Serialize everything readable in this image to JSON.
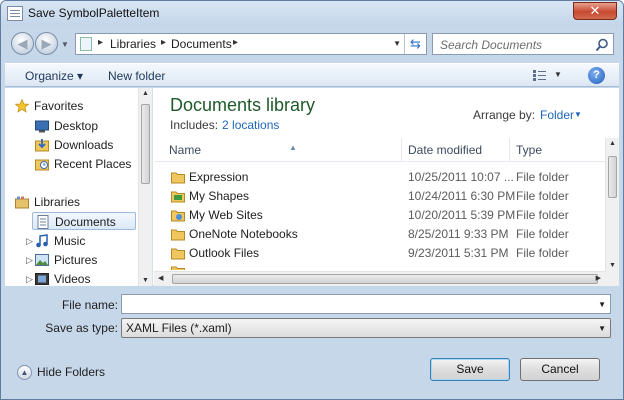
{
  "window": {
    "title": "Save SymbolPaletteItem",
    "close_glyph": "✕"
  },
  "address": {
    "crumbs": [
      "Libraries",
      "Documents"
    ],
    "separator": "▸",
    "search_placeholder": "Search Documents"
  },
  "toolbar": {
    "organize_label": "Organize ▾",
    "new_folder_label": "New folder",
    "help_glyph": "?"
  },
  "sidebar": {
    "favorites": {
      "label": "Favorites",
      "items": [
        {
          "label": "Desktop",
          "icon": "desktop-icon"
        },
        {
          "label": "Downloads",
          "icon": "downloads-icon"
        },
        {
          "label": "Recent Places",
          "icon": "recent-places-icon"
        }
      ]
    },
    "libraries": {
      "label": "Libraries",
      "items": [
        {
          "label": "Documents",
          "icon": "documents-icon",
          "selected": true
        },
        {
          "label": "Music",
          "icon": "music-icon"
        },
        {
          "label": "Pictures",
          "icon": "pictures-icon"
        },
        {
          "label": "Videos",
          "icon": "videos-icon"
        }
      ]
    }
  },
  "library_header": {
    "title": "Documents library",
    "includes_label": "Includes:",
    "includes_link": "2 locations",
    "arrange_label": "Arrange by:",
    "arrange_value": "Folder"
  },
  "columns": {
    "name": "Name",
    "date": "Date modified",
    "type": "Type"
  },
  "files": [
    {
      "name": "Expression",
      "date": "10/25/2011 10:07 ...",
      "type": "File folder",
      "icon": "folder-icon"
    },
    {
      "name": "My Shapes",
      "date": "10/24/2011 6:30 PM",
      "type": "File folder",
      "icon": "shapes-folder-icon"
    },
    {
      "name": "My Web Sites",
      "date": "10/20/2011 5:39 PM",
      "type": "File folder",
      "icon": "web-folder-icon"
    },
    {
      "name": "OneNote Notebooks",
      "date": "8/25/2011 9:33 PM",
      "type": "File folder",
      "icon": "folder-icon"
    },
    {
      "name": "Outlook Files",
      "date": "9/23/2011 5:31 PM",
      "type": "File folder",
      "icon": "folder-icon"
    }
  ],
  "form": {
    "file_name_label": "File name:",
    "file_name_value": "",
    "save_as_type_label": "Save as type:",
    "save_as_type_value": "XAML Files (*.xaml)"
  },
  "footer": {
    "hide_folders_label": "Hide Folders",
    "save_label": "Save",
    "cancel_label": "Cancel"
  },
  "colors": {
    "library_title": "#1e5a2a",
    "link": "#1e66b8",
    "window_frame": "#c7d7ea"
  }
}
